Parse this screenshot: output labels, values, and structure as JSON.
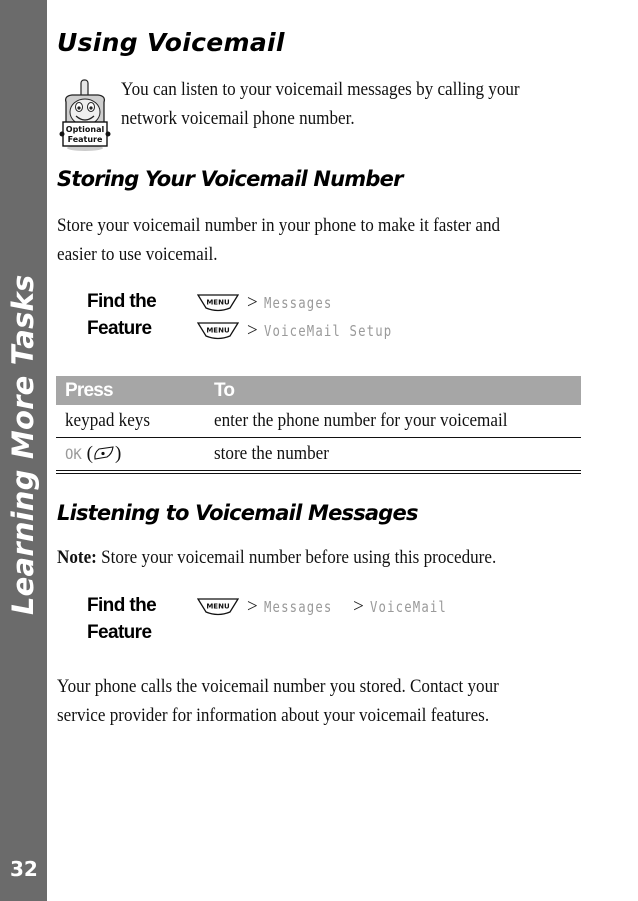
{
  "sidebar": {
    "section_title": "Learning More Tasks",
    "page_number": "32",
    "background_color": "#6b6b6b"
  },
  "main": {
    "title": "Using Voicemail",
    "optional_feature_badge": {
      "icon": "optional-feature-phone-icon",
      "line1": "Optional",
      "line2": "Feature"
    },
    "intro": [
      "You can listen to your voicemail messages by calling your",
      "network voicemail phone number."
    ],
    "sections": [
      {
        "heading": "Storing Your Voicemail Number",
        "body": [
          "Store your voicemail number in your phone to make it faster and",
          "easier to use voicemail."
        ],
        "find_feature": {
          "label_line1": "Find the",
          "label_line2": "Feature",
          "paths": [
            {
              "key": "MENU",
              "items": [
                "Messages"
              ]
            },
            {
              "key": "MENU",
              "items": [
                "VoiceMail Setup"
              ]
            }
          ]
        },
        "table": {
          "header_color": "#a6a6a6",
          "columns": [
            "Press",
            "To"
          ],
          "rows": [
            {
              "press": "keypad keys",
              "to": "enter the phone number for your voicemail"
            },
            {
              "press_key": "OK",
              "press_icon": "ok-key-icon",
              "to": "store the number"
            }
          ]
        }
      },
      {
        "heading": "Listening to Voicemail Messages",
        "note_label": "Note:",
        "note_text": "Store your voicemail number before using this procedure.",
        "find_feature": {
          "label_line1": "Find the",
          "label_line2": "Feature",
          "paths": [
            {
              "key": "MENU",
              "items": [
                "Messages",
                "VoiceMail"
              ]
            }
          ]
        },
        "body": [
          "Your phone calls the voicemail number you stored. Contact your",
          "service provider for information about your voicemail features."
        ]
      }
    ],
    "separator": ">"
  }
}
